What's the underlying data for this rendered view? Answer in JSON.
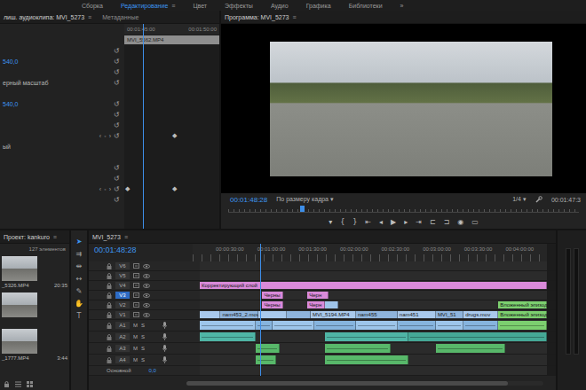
{
  "workspace": {
    "tabs": [
      {
        "label": "Сборка",
        "selected": false
      },
      {
        "label": "Редактирование",
        "selected": true
      },
      {
        "label": "Цвет",
        "selected": false
      },
      {
        "label": "Эффекты",
        "selected": false
      },
      {
        "label": "Аудио",
        "selected": false
      },
      {
        "label": "Графика",
        "selected": false
      },
      {
        "label": "Библиотеки",
        "selected": false
      }
    ],
    "menu_glyph": "≡",
    "more": "»"
  },
  "effect_controls": {
    "tabs": [
      {
        "label": "лиш. аудиоклипа: MVI_5273",
        "selected": true
      },
      {
        "label": "Метаданные",
        "selected": false
      }
    ],
    "ruler": [
      "00:01:45:00",
      "00:01:50:00"
    ],
    "clip": "MVI_5562.MP4",
    "playhead": 0.2,
    "reset_glyph": "↺",
    "nav_glyphs": [
      "‹",
      "◦",
      "›"
    ],
    "keyframe_glyph": "◆",
    "rows": [
      {
        "label": "",
        "value": "",
        "nav": false,
        "reset": true,
        "keyframes": []
      },
      {
        "label": "",
        "value": "540,0",
        "nav": false,
        "reset": true,
        "keyframes": []
      },
      {
        "label": "",
        "value": "",
        "nav": false,
        "reset": true,
        "keyframes": []
      },
      {
        "label": "ерный масштаб",
        "value": "",
        "nav": false,
        "reset": true,
        "keyframes": []
      },
      {
        "label": "",
        "value": "",
        "nav": false,
        "reset": false,
        "keyframes": []
      },
      {
        "label": "",
        "value": "540,0",
        "nav": false,
        "reset": true,
        "keyframes": []
      },
      {
        "label": "",
        "value": "",
        "nav": false,
        "reset": true,
        "keyframes": []
      },
      {
        "label": "",
        "value": "",
        "nav": false,
        "reset": true,
        "keyframes": []
      },
      {
        "label": "",
        "value": "",
        "nav": true,
        "reset": true,
        "keyframes": [
          0.53
        ]
      },
      {
        "label": "ый",
        "value": "",
        "nav": false,
        "reset": false,
        "keyframes": []
      },
      {
        "label": "",
        "value": "",
        "nav": false,
        "reset": false,
        "keyframes": []
      },
      {
        "label": "",
        "value": "",
        "nav": false,
        "reset": true,
        "keyframes": []
      },
      {
        "label": "",
        "value": "",
        "nav": false,
        "reset": true,
        "keyframes": []
      },
      {
        "label": "",
        "value": "",
        "nav": true,
        "reset": true,
        "keyframes": [
          0.03,
          0.53
        ]
      },
      {
        "label": "",
        "value": "",
        "nav": false,
        "reset": true,
        "keyframes": []
      }
    ]
  },
  "program": {
    "title": "Программа: MVI_5273",
    "time": "00:01:48:28",
    "fit": "По размеру кадра",
    "quality": "1/4",
    "dropdown_glyph": "▾",
    "duration": "00:01:47:3",
    "playhead": 0.21,
    "transport": [
      "▾",
      "{",
      "}",
      "⇤",
      "◂",
      "▶",
      "▸",
      "⇥",
      "⊏",
      "⊐",
      "◉",
      "▭"
    ]
  },
  "project": {
    "title": "Проект: kankuro",
    "count": "127 элементов",
    "items": [
      {
        "name": "_5326.MP4",
        "duration": "20:35"
      },
      {
        "name": "",
        "duration": ""
      },
      {
        "name": "_1777.MP4",
        "duration": "3:44"
      }
    ]
  },
  "tools": [
    {
      "glyph": "➤",
      "selected": true
    },
    {
      "glyph": "⇉",
      "selected": false
    },
    {
      "glyph": "⇹",
      "selected": false
    },
    {
      "glyph": "↔",
      "selected": false
    },
    {
      "glyph": "✎",
      "selected": false
    },
    {
      "glyph": "✋",
      "selected": false
    },
    {
      "glyph": "T",
      "selected": false
    }
  ],
  "timeline": {
    "tab": "MVI_5273",
    "time": "00:01:48:28",
    "ruler": [
      "00:00:30:00",
      "00:01:00:00",
      "00:01:30:00",
      "00:02:00:00",
      "00:02:30:00",
      "00:03:00:00",
      "00:03:30:00",
      "00:04:00:00"
    ],
    "playhead": 0.215,
    "audio_buttons": [
      "M",
      "S"
    ],
    "tracks": [
      {
        "name": "V6",
        "kind": "video",
        "selected": false,
        "clips": []
      },
      {
        "name": "V5",
        "kind": "video",
        "selected": false,
        "clips": []
      },
      {
        "name": "V4",
        "kind": "video",
        "selected": false,
        "clips": [
          {
            "name": "Корректирующий слой",
            "start": 0.0,
            "end": 1.0,
            "color": "#d98ad9"
          }
        ]
      },
      {
        "name": "V3",
        "kind": "video",
        "selected": true,
        "clips": [
          {
            "name": "Черны",
            "start": 0.18,
            "end": 0.24,
            "color": "#d98ad9"
          },
          {
            "name": "Черн",
            "start": 0.31,
            "end": 0.37,
            "color": "#d98ad9"
          }
        ]
      },
      {
        "name": "V2",
        "kind": "video",
        "selected": false,
        "clips": [
          {
            "name": "Черны",
            "start": 0.18,
            "end": 0.24,
            "color": "#d98ad9"
          },
          {
            "name": "Черн",
            "start": 0.31,
            "end": 0.36,
            "color": "#d98ad9"
          },
          {
            "name": "",
            "start": 0.36,
            "end": 0.4,
            "color": "#9fc4ea"
          },
          {
            "name": "Вложенный эпизод",
            "start": 0.86,
            "end": 1.0,
            "color": "#7ccf6f"
          }
        ]
      },
      {
        "name": "V1",
        "kind": "video",
        "selected": false,
        "clips": [
          {
            "name": "",
            "start": 0.0,
            "end": 0.06,
            "color": "#a9c9ec"
          },
          {
            "name": "nam453_2.mov",
            "start": 0.06,
            "end": 0.17,
            "color": "#8fb4dc"
          },
          {
            "name": "",
            "start": 0.17,
            "end": 0.25,
            "color": "#a9c9ec"
          },
          {
            "name": "",
            "start": 0.25,
            "end": 0.32,
            "color": "#8fb4dc"
          },
          {
            "name": "MVI_5194.MP4",
            "start": 0.32,
            "end": 0.45,
            "color": "#a9c9ec"
          },
          {
            "name": "nam455",
            "start": 0.45,
            "end": 0.57,
            "color": "#8fb4dc"
          },
          {
            "name": "nam451",
            "start": 0.57,
            "end": 0.68,
            "color": "#a9c9ec"
          },
          {
            "name": "MVI_51",
            "start": 0.68,
            "end": 0.76,
            "color": "#8fb4dc"
          },
          {
            "name": "drugs.mov",
            "start": 0.76,
            "end": 0.86,
            "color": "#a9c9ec"
          },
          {
            "name": "Вложенный эпизод",
            "start": 0.86,
            "end": 1.0,
            "color": "#7ccf6f"
          }
        ]
      },
      {
        "name": "A1",
        "kind": "audio",
        "selected": false,
        "clips": [
          {
            "name": "",
            "start": 0.0,
            "end": 0.16,
            "color": "#9dc5ea"
          },
          {
            "name": "",
            "start": 0.16,
            "end": 0.21,
            "color": "#86b4de"
          },
          {
            "name": "",
            "start": 0.21,
            "end": 0.33,
            "color": "#9dc5ea"
          },
          {
            "name": "",
            "start": 0.33,
            "end": 0.45,
            "color": "#86b4de"
          },
          {
            "name": "",
            "start": 0.45,
            "end": 0.57,
            "color": "#9dc5ea"
          },
          {
            "name": "",
            "start": 0.57,
            "end": 0.68,
            "color": "#86b4de"
          },
          {
            "name": "",
            "start": 0.68,
            "end": 0.76,
            "color": "#9dc5ea"
          },
          {
            "name": "",
            "start": 0.76,
            "end": 0.86,
            "color": "#86b4de"
          },
          {
            "name": "",
            "start": 0.86,
            "end": 1.0,
            "color": "#7ccf6f"
          }
        ]
      },
      {
        "name": "A2",
        "kind": "audio",
        "selected": false,
        "clips": [
          {
            "name": "",
            "start": 0.0,
            "end": 0.16,
            "color": "#4fb5a5"
          },
          {
            "name": "",
            "start": 0.36,
            "end": 0.6,
            "color": "#4fb5a5"
          },
          {
            "name": "",
            "start": 0.6,
            "end": 1.0,
            "color": "#45a896"
          }
        ]
      },
      {
        "name": "A3",
        "kind": "audio",
        "selected": false,
        "clips": [
          {
            "name": "",
            "start": 0.16,
            "end": 0.23,
            "color": "#58b86a"
          },
          {
            "name": "",
            "start": 0.36,
            "end": 0.55,
            "color": "#58b86a"
          },
          {
            "name": "",
            "start": 0.68,
            "end": 0.88,
            "color": "#58b86a"
          }
        ]
      },
      {
        "name": "A4",
        "kind": "audio",
        "selected": false,
        "clips": [
          {
            "name": "",
            "start": 0.16,
            "end": 0.22,
            "color": "#58b86a"
          },
          {
            "name": "",
            "start": 0.36,
            "end": 0.6,
            "color": "#58b86a"
          }
        ]
      }
    ],
    "master": {
      "name": "Основной",
      "value": "0,0"
    }
  }
}
